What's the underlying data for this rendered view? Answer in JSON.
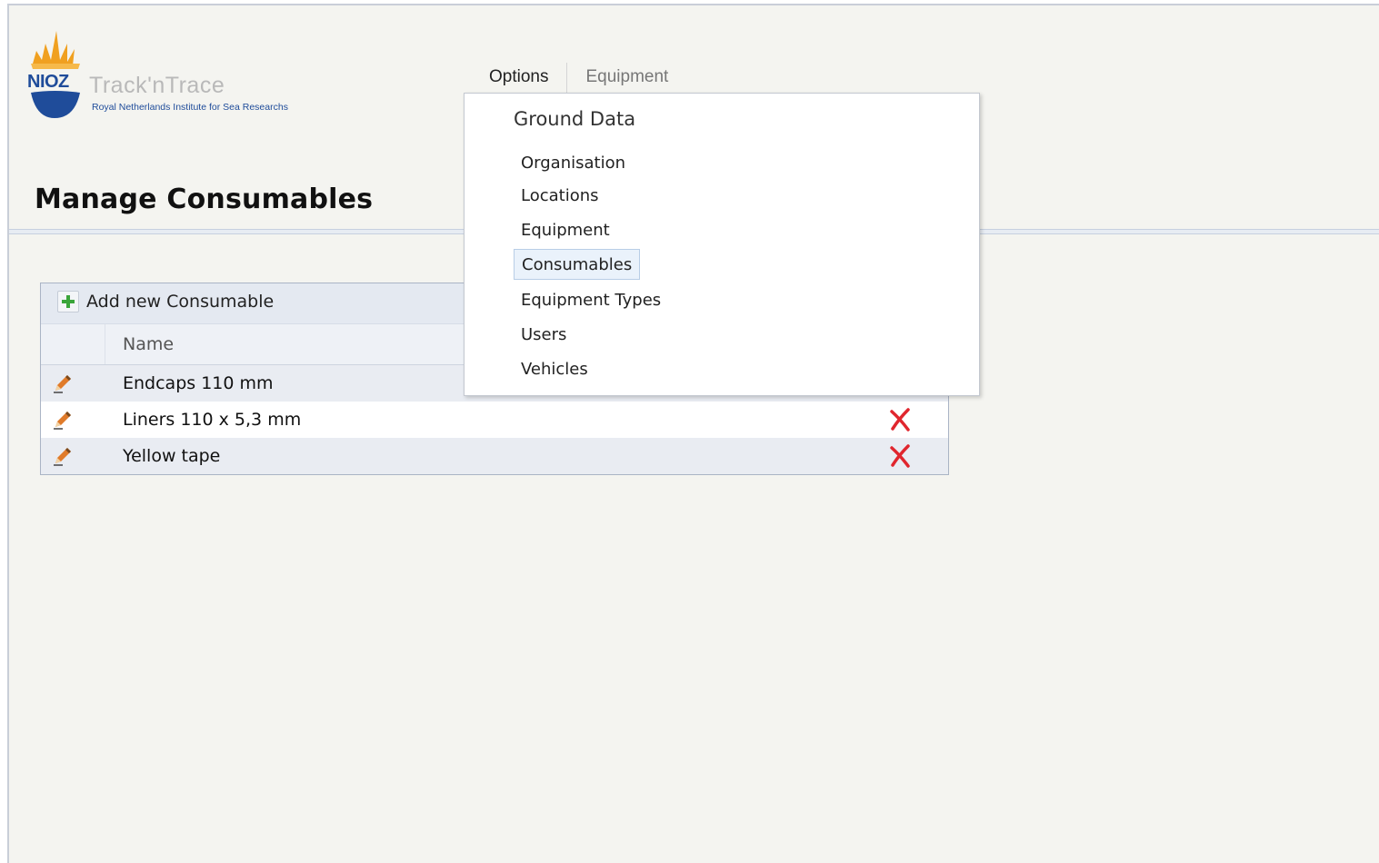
{
  "logo": {
    "brand": "NIOZ",
    "app_name": "Track'nTrace",
    "subtitle": "Royal Netherlands Institute for Sea Researchs"
  },
  "nav": {
    "items": [
      {
        "label": "Options",
        "state": "active"
      },
      {
        "label": "Equipment",
        "state": "inactive"
      }
    ]
  },
  "page": {
    "title": "Manage Consumables"
  },
  "grid": {
    "add_label": "Add new Consumable",
    "columns": [
      "Name"
    ],
    "rows": [
      {
        "name": "Endcaps 110 mm"
      },
      {
        "name": "Liners 110 x 5,3 mm"
      },
      {
        "name": "Yellow tape"
      }
    ]
  },
  "dropdown": {
    "heading": "Ground Data",
    "items": [
      {
        "label": "Organisation"
      },
      {
        "label": "Locations"
      },
      {
        "label": "Equipment"
      },
      {
        "label": "Consumables",
        "selected": true
      },
      {
        "label": "Equipment Types"
      },
      {
        "label": "Users"
      },
      {
        "label": "Vehicles"
      }
    ]
  },
  "colors": {
    "delete": "#e0262e",
    "add": "#3aa53a",
    "edit": "#d9661c",
    "logo_orange": "#f0a020",
    "logo_blue": "#1f4c9a"
  }
}
